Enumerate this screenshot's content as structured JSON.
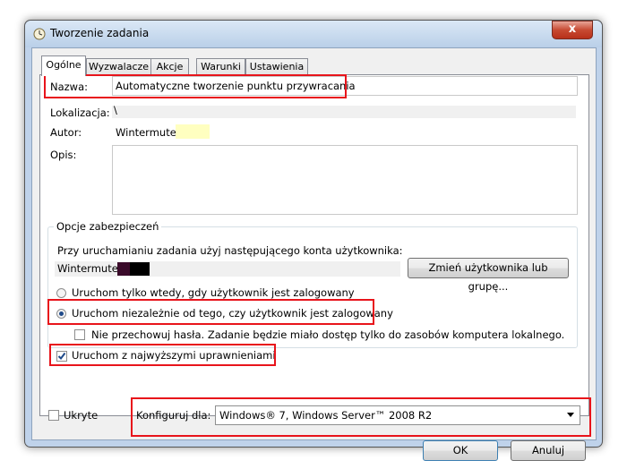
{
  "window": {
    "title": "Tworzenie zadania",
    "close_glyph": "x"
  },
  "tabs": [
    {
      "label": "Ogólne",
      "active": true
    },
    {
      "label": "Wyzwalacze",
      "active": false
    },
    {
      "label": "Akcje",
      "active": false
    },
    {
      "label": "Warunki",
      "active": false
    },
    {
      "label": "Ustawienia",
      "active": false
    }
  ],
  "general": {
    "name_label": "Nazwa:",
    "name_value": "Automatyczne tworzenie punktu przywracania",
    "location_label": "Lokalizacja:",
    "location_value": "\\",
    "author_label": "Autor:",
    "author_value": "Wintermute\\",
    "description_label": "Opis:",
    "description_value": ""
  },
  "security": {
    "group_title": "Opcje zabezpieczeń",
    "account_prompt": "Przy uruchamianiu zadania użyj następującego konta użytkownika:",
    "account_value": "Wintermute\\",
    "change_user_button": "Zmień użytkownika lub grupę...",
    "radio_logged_on": "Uruchom tylko wtedy, gdy użytkownik jest zalogowany",
    "radio_regardless": "Uruchom niezależnie od tego, czy użytkownik jest zalogowany",
    "radio_selected": "regardless",
    "no_store_password": "Nie przechowuj hasła. Zadanie będzie miało dostęp tylko do zasobów komputera lokalnego.",
    "no_store_password_checked": false,
    "highest_privileges": "Uruchom z najwyższymi uprawnieniami",
    "highest_privileges_checked": true
  },
  "hidden_label": "Ukryte",
  "hidden_checked": false,
  "configure_label": "Konfiguruj dla:",
  "configure_value": "Windows® 7, Windows Server™ 2008 R2",
  "buttons": {
    "ok": "OK",
    "cancel": "Anuluj"
  },
  "colors": {
    "highlight_red": "#e8141b",
    "redacted_yellow": "#ffffc0",
    "redacted_dark": "#3a0a2a"
  }
}
